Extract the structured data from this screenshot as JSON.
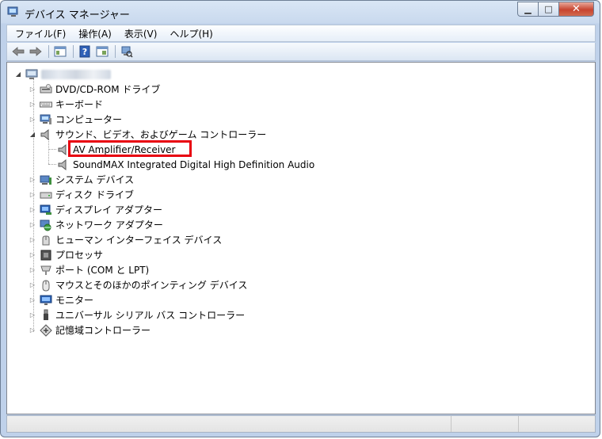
{
  "window": {
    "title": "デバイス マネージャー",
    "minimize_glyph": "▁",
    "maximize_glyph": "□",
    "close_glyph": "✕"
  },
  "menu": [
    {
      "label": "ファイル(F)"
    },
    {
      "label": "操作(A)"
    },
    {
      "label": "表示(V)"
    },
    {
      "label": "ヘルプ(H)"
    }
  ],
  "toolbar": {
    "icons": [
      "back-arrow-icon",
      "forward-arrow-icon",
      "properties-view-icon",
      "help-icon",
      "panel-view-icon",
      "scan-hardware-icon"
    ]
  },
  "tree": {
    "root": {
      "expander": "◢"
    },
    "categories": [
      {
        "label": "DVD/CD-ROM ドライブ",
        "icon": "dvd-drive-icon",
        "expander": "▷"
      },
      {
        "label": "キーボード",
        "icon": "keyboard-icon",
        "expander": "▷"
      },
      {
        "label": "コンピューター",
        "icon": "computer-icon",
        "expander": "▷"
      },
      {
        "label": "サウンド、ビデオ、およびゲーム コントローラー",
        "icon": "speaker-icon",
        "expander": "◢",
        "children": [
          {
            "label": "AV Amplifier/Receiver",
            "icon": "speaker-icon"
          },
          {
            "label": "SoundMAX Integrated Digital High Definition Audio",
            "icon": "speaker-icon"
          }
        ]
      },
      {
        "label": "システム デバイス",
        "icon": "system-device-icon",
        "expander": "▷"
      },
      {
        "label": "ディスク ドライブ",
        "icon": "disk-drive-icon",
        "expander": "▷"
      },
      {
        "label": "ディスプレイ アダプター",
        "icon": "display-adapter-icon",
        "expander": "▷"
      },
      {
        "label": "ネットワーク アダプター",
        "icon": "network-adapter-icon",
        "expander": "▷"
      },
      {
        "label": "ヒューマン インターフェイス デバイス",
        "icon": "hid-icon",
        "expander": "▷"
      },
      {
        "label": "プロセッサ",
        "icon": "processor-icon",
        "expander": "▷"
      },
      {
        "label": "ポート (COM と LPT)",
        "icon": "port-icon",
        "expander": "▷"
      },
      {
        "label": "マウスとそのほかのポインティング デバイス",
        "icon": "mouse-icon",
        "expander": "▷"
      },
      {
        "label": "モニター",
        "icon": "monitor-icon",
        "expander": "▷"
      },
      {
        "label": "ユニバーサル シリアル バス コントローラー",
        "icon": "usb-icon",
        "expander": "▷"
      },
      {
        "label": "記憶域コントローラー",
        "icon": "storage-controller-icon",
        "expander": "▷"
      }
    ]
  },
  "colors": {
    "highlight_border": "#e8000f",
    "title_bar": "#d9e6f5",
    "close_button": "#c7442f"
  }
}
